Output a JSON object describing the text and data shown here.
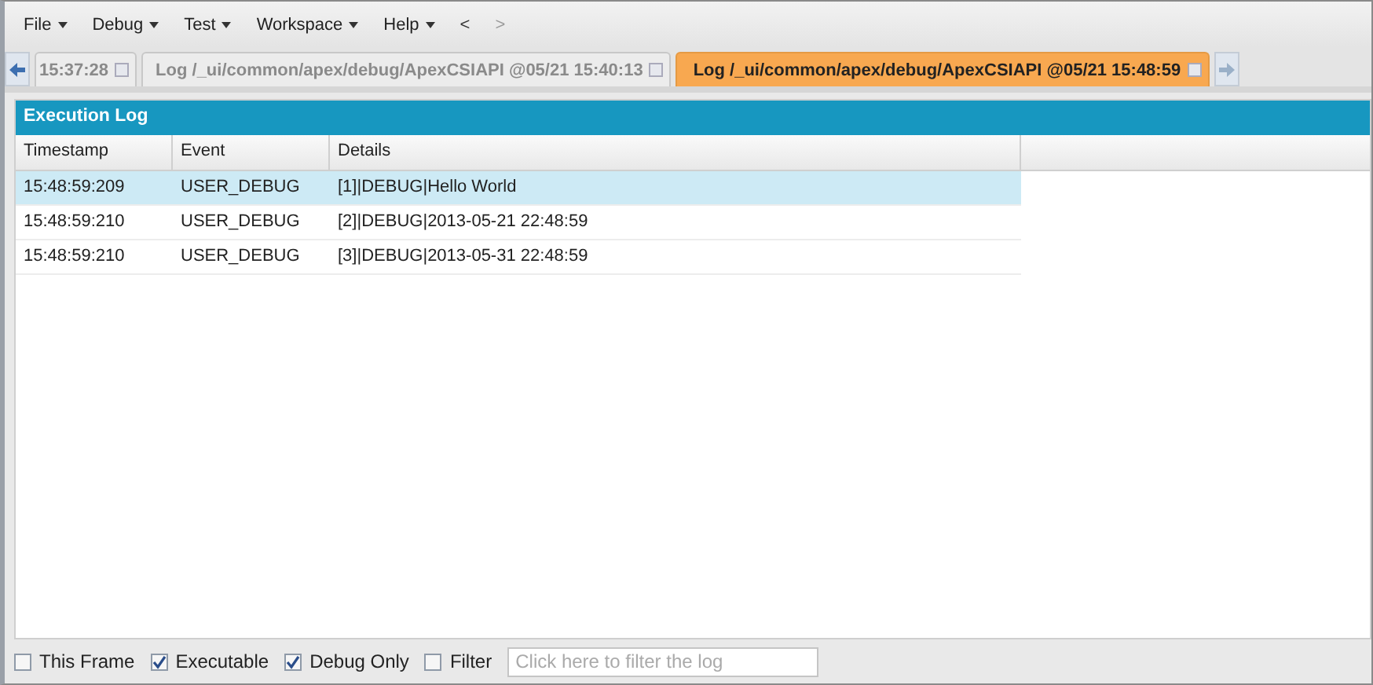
{
  "menu": [
    {
      "label": "File"
    },
    {
      "label": "Debug"
    },
    {
      "label": "Test"
    },
    {
      "label": "Workspace"
    },
    {
      "label": "Help"
    }
  ],
  "nav": [
    "<",
    ">"
  ],
  "tabs": [
    {
      "label": "15:37:28",
      "selected": false
    },
    {
      "label": "Log /_ui/common/apex/debug/ApexCSIAPI @05/21 15:40:13",
      "selected": false
    },
    {
      "label": "Log /_ui/common/apex/debug/ApexCSIAPI @05/21 15:48:59",
      "selected": true
    }
  ],
  "panel": {
    "title": "Execution Log"
  },
  "table": {
    "columns": [
      "Timestamp",
      "Event",
      "Details"
    ],
    "rows": [
      {
        "cells": [
          "15:48:59:209",
          "USER_DEBUG",
          "[1]|DEBUG|Hello World"
        ],
        "selected": true
      },
      {
        "cells": [
          "15:48:59:210",
          "USER_DEBUG",
          "[2]|DEBUG|2013-05-21 22:48:59"
        ],
        "selected": false
      },
      {
        "cells": [
          "15:48:59:210",
          "USER_DEBUG",
          "[3]|DEBUG|2013-05-31 22:48:59"
        ],
        "selected": false
      }
    ]
  },
  "filters": [
    {
      "label": "This Frame",
      "checked": false
    },
    {
      "label": "Executable",
      "checked": true
    },
    {
      "label": "Debug Only",
      "checked": true
    },
    {
      "label": "Filter",
      "checked": false
    }
  ],
  "filter_field": {
    "placeholder": "Click here to filter the log"
  }
}
